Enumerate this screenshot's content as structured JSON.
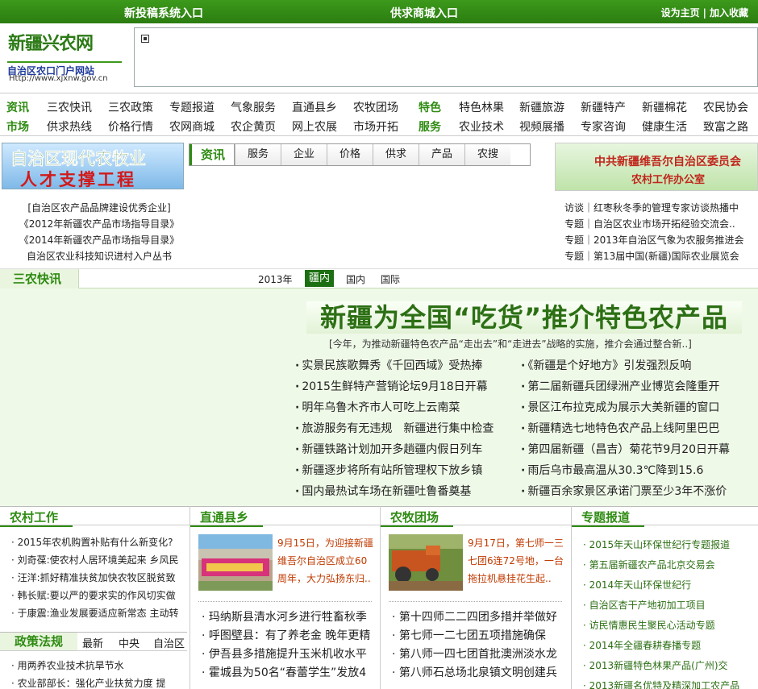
{
  "topbar": {
    "submit": "新投稿系统入口",
    "mall": "供求商城入口",
    "set_home": "设为主页",
    "bookmark": "加入收藏"
  },
  "logo": {
    "name": "新疆兴农网",
    "subtitle": "自治区农口门户网站",
    "url": "Http://www.xjxnw.gov.cn"
  },
  "nav": {
    "row1": [
      "资讯",
      "三农快讯",
      "三农政策",
      "专题报道",
      "气象服务",
      "直通县乡",
      "农牧团场",
      "特色",
      "特色林果",
      "新疆旅游",
      "新疆特产",
      "新疆棉花",
      "农民协会"
    ],
    "row2": [
      "市场",
      "供求热线",
      "价格行情",
      "农网商城",
      "农企黄页",
      "网上农展",
      "市场开拓",
      "服务",
      "农业技术",
      "视频展播",
      "专家咨询",
      "健康生活",
      "致富之路"
    ]
  },
  "promo_left": {
    "line1": "自治区现代农牧业",
    "line2": "人才支撑工程"
  },
  "tabs": {
    "active": "资讯",
    "items": [
      "服务",
      "企业",
      "价格",
      "供求",
      "产品",
      "农搜"
    ]
  },
  "promo_right": {
    "line1": "中共新疆维吾尔自治区委员会",
    "line2": "农村工作办公室"
  },
  "left_links": [
    "[自治区农产品品牌建设优秀企业]",
    "《2012年新疆农产品市场指导目录》",
    "《2014年新疆农产品市场指导目录》",
    "自治区农业科技知识进村入户丛书"
  ],
  "right_links": [
    "访谈｜红枣秋冬季的管理专家访谈热播中",
    "专题｜自治区农业市场开拓经验交流会..",
    "专题｜2013年自治区气象为农服务推进会",
    "专题｜第13届中国(新疆)国际农业展览会"
  ],
  "sannong": {
    "title": "三农快讯",
    "filters": {
      "year": "2013年",
      "active": "疆内",
      "domestic": "国内",
      "intl": "国际"
    },
    "headline": "新疆为全国“吃货”推介特色农产品",
    "summary": "[今年，为推动新疆特色农产品“走出去”和“走进去”战略的实施，推介会通过整合新..]",
    "news_left": [
      "实景民族歌舞秀《千回西域》受热捧",
      "2015生鲜特产营销论坛9月18日开幕",
      "明年乌鲁木齐市人可吃上云南菜",
      "旅游服务有无违规　新疆进行集中检查",
      "新疆铁路计划加开多趟疆内假日列车",
      "新疆逐步将所有站所管理权下放乡镇",
      "国内最热试车场在新疆吐鲁番奠基"
    ],
    "news_right": [
      "《新疆是个好地方》引发强烈反响",
      "第二届新疆兵团绿洲产业博览会隆重开",
      "景区江布拉克成为展示大美新疆的窗口",
      "新疆精选七地特色农产品上线阿里巴巴",
      "第四届新疆（昌吉）菊花节9月20日开幕",
      "雨后乌市最高温从30.3℃降到15.6",
      "新疆百余家景区承诺门票至少3年不涨价"
    ]
  },
  "rural_work": {
    "title": "农村工作",
    "items": [
      "2015年农机购置补贴有什么新变化?",
      "刘奇葆:使农村人居环境美起来 乡风民",
      "汪洋:抓好精准扶贫加快农牧区脱贫致",
      "韩长赋:要以严的要求实的作风切实做",
      "于康震:渔业发展要适应新常态 主动转"
    ]
  },
  "policy": {
    "title": "政策法规",
    "filters": [
      "最新",
      "中央",
      "自治区"
    ],
    "items": [
      "用两养农业技术抗旱节水",
      "农业部部长：强化产业扶贫力度 提"
    ]
  },
  "county": {
    "title": "直通县乡",
    "photo_caption": "9月15日，为迎接新疆维吾尔自治区成立60周年，大力弘扬东归..",
    "items": [
      "玛纳斯县清水河乡进行牲畜秋季",
      "呼图壁县：有了养老金 晚年更精",
      "伊吾县多措施提升玉米机收水平",
      "霍城县为50名“春蕾学生”发放4"
    ]
  },
  "farm": {
    "title": "农牧团场",
    "photo_caption": "9月17日，第七师一三七团6连72号地，一台拖拉机悬挂花生起..",
    "items": [
      "第十四师二二四团多措并举做好",
      "第七师一二七团五项措施确保",
      "第八师一四七团首批澳洲淡水龙",
      "第八师石总场北泉镇文明创建兵"
    ]
  },
  "special": {
    "title": "专题报道",
    "items": [
      "2015年天山环保世纪行专题报道",
      "第五届新疆农产品北京交易会",
      "2014年天山环保世纪行",
      "自治区杏干产地初加工项目",
      "访民情惠民生聚民心活动专题",
      "2014年全疆春耕春播专题",
      "2013新疆特色林果产品(广州)交",
      "2013新疆名优特及精深加工农产品"
    ]
  }
}
